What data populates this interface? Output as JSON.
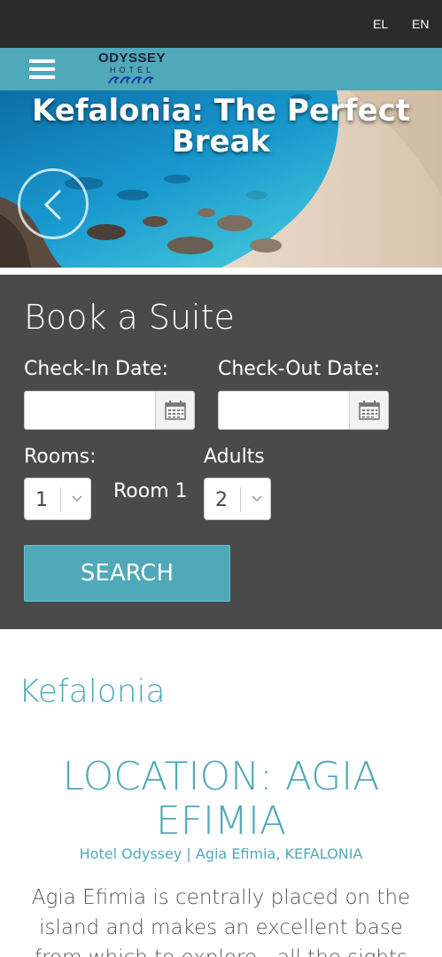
{
  "topbar": {
    "languages": [
      "EL",
      "EN"
    ]
  },
  "navbar": {
    "logo_name": "ODYSSEY",
    "logo_sub": "HOTEL"
  },
  "hero": {
    "title": "Kefalonia: The Perfect Break"
  },
  "booking": {
    "title": "Book a Suite",
    "checkin_label": "Check-In Date:",
    "checkout_label": "Check-Out Date:",
    "checkin_value": "",
    "checkout_value": "",
    "rooms_label": "Rooms:",
    "rooms_value": "1",
    "room_name": "Room 1",
    "adults_label": "Adults",
    "adults_value": "2",
    "search_label": "SEARCH"
  },
  "content": {
    "section_title": "Kefalonia",
    "location_title": "LOCATION: AGIA EFIMIA",
    "location_sub": "Hotel Odyssey | Agia Efimia, KEFALONIA",
    "body": "Agia Efimia is centrally placed on the island and makes an excellent base from which to explore - all the sights and the best"
  },
  "colors": {
    "accent": "#4fa9b8",
    "topbar": "#2b2b2b",
    "booking_bg": "#4a4a4a"
  }
}
